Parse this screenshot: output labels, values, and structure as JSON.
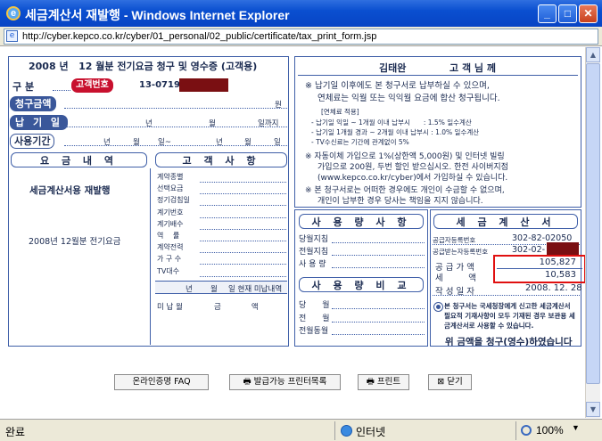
{
  "window": {
    "title": "세금계산서 재발행 - Windows Internet Explorer",
    "url": "http://cyber.kepco.co.kr/cyber/01_personal/02_public/certificate/tax_print_form.jsp"
  },
  "bill": {
    "title_year": "2008",
    "title_year_unit": "년",
    "title_month": "12",
    "title_rest": "월분 전기요금 청구 및 영수증 (고객용)",
    "division_label": "구 분",
    "customer_no_label": "고객번호",
    "customer_no": "13-0719-",
    "billed_amount_label": "청구금액",
    "won": "원",
    "due_label": "납 기 일",
    "year": "년",
    "month": "월",
    "day": "일",
    "due_suffix": "일까지",
    "period_label": "사용기간",
    "period_sep": "일~",
    "charges_header": "요 금 내 역",
    "customer_header": "고 객 사 항",
    "reissue_text": "세금계산서용 재발행",
    "bill_month_text": "2008년 12월분 전기요금",
    "customer_items": [
      "계약종별",
      "선택요금",
      "정기검침일",
      "계기번호",
      "계기배수",
      "역　 률",
      "계약전력",
      "가 구 수",
      "TV대수"
    ],
    "unpaid_header": [
      "년",
      "월",
      "일 현재 미납내역"
    ],
    "unpaid_label": "미 납 월",
    "unpaid_amount": "금　　　　액"
  },
  "right": {
    "customer_name": "김태완",
    "customer_honor": "고 객 님 께",
    "notice1_l1": "※ 납기일 이후에도 본 청구서로 납부하실 수 있으며,",
    "notice1_l2": "연체료는 익월 또는 익익월 요금에 합산 청구됩니다.",
    "notice_rate_title": "[연체료 적용]",
    "notice_rate1": "- 납기일 익일 ~ 1개월 이내 납부시　　: 1.5% 일수계산",
    "notice_rate2": "- 납기일 1개월 경과 ~ 2개월 이내 납부시 : 1.0% 일수계산",
    "notice_rate3": "- TV수신료는 기간에 관계없이 5%",
    "notice2_l1": "※ 자동이체 가입으로 1%(상한액 5,000원) 및 인터넷 빌링",
    "notice2_l2": "가입으로 200원, 두번 할인 받으십시오. 한전 사이버지점",
    "notice2_l3": "(www.kepco.co.kr/cyber)에서 가입하실 수 있습니다.",
    "notice3_l1": "※ 본 청구서로는 어떠한 경우에도 개인이 수금할 수 없으며,",
    "notice3_l2": "개인이 납부한 경우 당사는 책임을 지지 않습니다.",
    "usage_header": "사 용 량 사 항",
    "usage_items": [
      "당월지침",
      "전월지침",
      "사 용 량"
    ],
    "compare_header": "사 용 량 비 교",
    "compare_items": [
      "당　　월",
      "전　　월",
      "전월동월"
    ],
    "tax_header": "세 금 계 산 서",
    "supplier_reg_label": "공급자등록번호",
    "supplier_reg": "302-82-02050",
    "buyer_reg_label": "공급받는자등록번호",
    "buyer_reg": "302-02-",
    "supply_value_label": "공 급 가 액",
    "supply_value": "105,827",
    "tax_label": "세　　　액",
    "tax_value": "10,583",
    "date_label": "작 성 일 자",
    "date_value": "2008. 12. 28",
    "tax_note_l1": "본 청구서는 국세청장에게 신고한 세금계산서",
    "tax_note_l2": "필요적 기재사항이 모두 기재된 경우 보관용 세",
    "tax_note_l3": "금계산서로 사용할 수 있습니다.",
    "cut_text": "위 금액을 청구(영수)하였습니다"
  },
  "buttons": {
    "faq": "온라인증명 FAQ",
    "printers": "발급가능 프린터목록",
    "print": "프린트",
    "close": "닫기"
  },
  "status": {
    "left": "완료",
    "zone": "인터넷",
    "zoom": "100%"
  },
  "colors": {
    "frame": "#3f5fa8",
    "highlight": "#e01010",
    "redaction": "#7a0f12"
  }
}
